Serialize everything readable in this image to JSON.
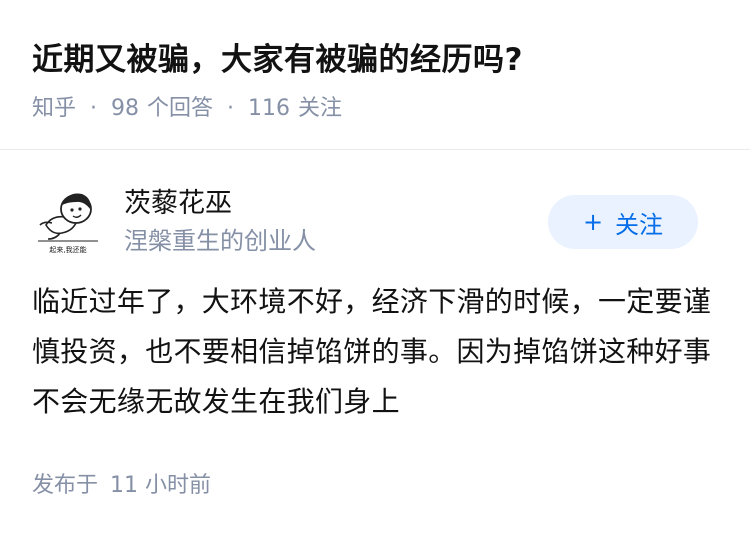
{
  "question": {
    "title": "近期又被骗，大家有被骗的经历吗?",
    "source": "知乎",
    "answers_count": "98",
    "answers_label": "个回答",
    "followers_count": "116",
    "followers_label": "关注",
    "separator": "·"
  },
  "answer": {
    "author": {
      "name": "茨藜花巫",
      "headline": "涅槃重生的创业人",
      "avatar_caption": "起来,我还能"
    },
    "follow_button": {
      "plus": "+",
      "label": "关注"
    },
    "content": "临近过年了，大环境不好，经济下滑的时候，一定要谨慎投资，也不要相信掉馅饼的事。因为掉馅饼这种好事不会无缘无故发生在我们身上",
    "publish": {
      "label": "发布于",
      "time": "11 小时前"
    }
  },
  "colors": {
    "text_primary": "#121212",
    "text_secondary": "#8590a6",
    "accent": "#056de8",
    "follow_bg": "#eaf2ff",
    "divider": "#ebebeb"
  }
}
